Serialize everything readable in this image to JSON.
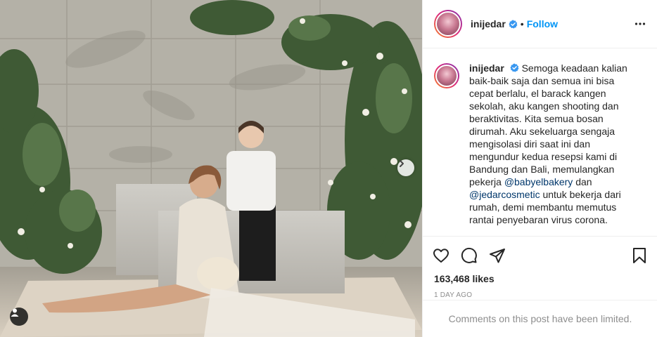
{
  "post": {
    "username": "inijedar",
    "follow_label": "Follow",
    "separator": "•",
    "caption_parts": {
      "p1": "Semoga keadaan kalian baik-baik saja dan semua ini bisa cepat berlalu, el barack kangen sekolah, aku kangen shooting dan beraktivitas. Kita semua bosan dirumah. Aku sekeluarga sengaja mengisolasi diri saat ini dan mengundur kedua resepsi kami di Bandung dan Bali, memulangkan pekerja ",
      "mention1": "@babyelbakery",
      "p2": " dan ",
      "mention2": "@jedarcosmetic",
      "p3": " untuk bekerja dari rumah, demi membantu memutus rantai penyebaran virus corona."
    },
    "likes": "163,468 likes",
    "time_ago": "1 DAY AGO",
    "comments_notice": "Comments on this post have been limited."
  },
  "icons": {
    "verified": "verified-badge-icon",
    "more": "more-options-icon",
    "like": "heart-icon",
    "comment": "comment-icon",
    "share": "share-icon",
    "save": "bookmark-icon",
    "next": "chevron-right-icon",
    "tag": "user-tag-icon"
  },
  "colors": {
    "accent": "#0095f6",
    "verified": "#3897f0",
    "secondary_text": "#8e8e8e",
    "mention": "#00376b"
  }
}
